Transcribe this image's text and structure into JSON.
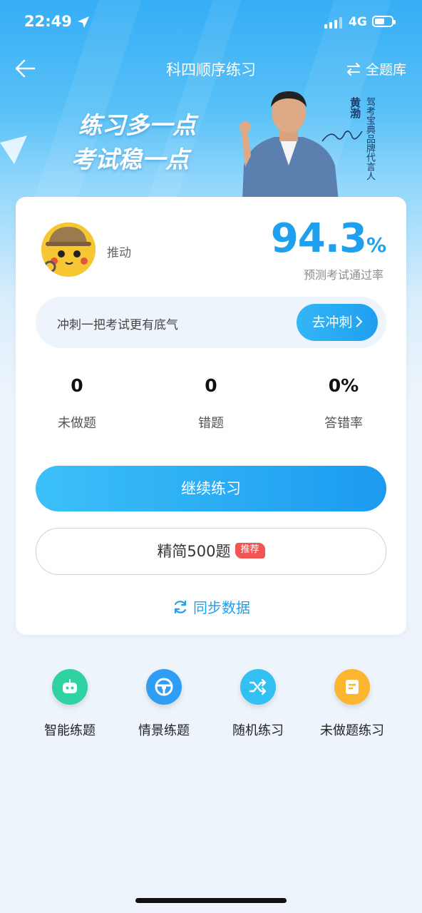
{
  "status_bar": {
    "time": "22:49",
    "network": "4G"
  },
  "nav": {
    "title": "科四顺序练习",
    "library_label": "全题库"
  },
  "banner": {
    "slogan_line1": "练习多一点",
    "slogan_line2": "考试稳一点",
    "endorser_name": "黄渤",
    "endorser_title": "驾考宝典品牌代言人"
  },
  "profile": {
    "username": "推动",
    "pass_rate_value": "94.3",
    "pass_rate_unit": "%",
    "pass_rate_label": "预测考试通过率"
  },
  "sprint": {
    "text": "冲刺一把考试更有底气",
    "button_label": "去冲刺"
  },
  "stats": [
    {
      "value": "0",
      "label": "未做题"
    },
    {
      "value": "0",
      "label": "错题"
    },
    {
      "value": "0%",
      "label": "答错率"
    }
  ],
  "actions": {
    "continue_label": "继续练习",
    "selected_label": "精简500题",
    "selected_badge": "推荐",
    "sync_label": "同步数据"
  },
  "tools": [
    {
      "label": "智能练题",
      "icon": "robot-icon",
      "color": "#2fd3a2"
    },
    {
      "label": "情景练题",
      "icon": "steering-wheel-icon",
      "color": "#2e9df5"
    },
    {
      "label": "随机练习",
      "icon": "shuffle-icon",
      "color": "#33c0f2"
    },
    {
      "label": "未做题练习",
      "icon": "note-icon",
      "color": "#fbb52e"
    }
  ],
  "colors": {
    "accent": "#1ea0ee",
    "badge": "#f25555"
  }
}
